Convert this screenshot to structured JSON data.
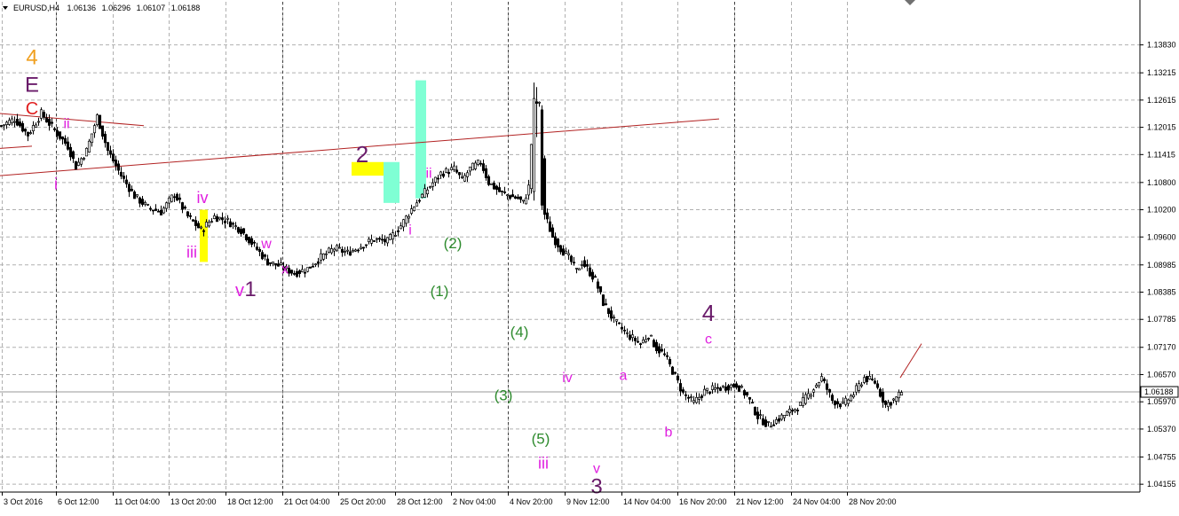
{
  "header": {
    "symbol": "EURUSD,H4",
    "open": "1.06136",
    "high": "1.06296",
    "low": "1.06107",
    "close": "1.06188"
  },
  "colors": {
    "bull": "#ffffff",
    "bear": "#000000",
    "grid": "#b0b0b0",
    "trendline": "#b22222",
    "yellow_box": "#ffff00",
    "teal_box": "#7fffd4",
    "pink": "#e020e0",
    "green": "#2e8b2e",
    "purple": "#6a1b6a",
    "orange": "#f0a020",
    "red": "#e02020",
    "price_line": "#9a9a9a"
  },
  "chart_data": {
    "type": "candlestick",
    "ylim": [
      1.0408,
      1.1435
    ],
    "y_ticks": [
      "1.13830",
      "1.13215",
      "1.12615",
      "1.12015",
      "1.11415",
      "1.10800",
      "1.10200",
      "1.09600",
      "1.08985",
      "1.08385",
      "1.07785",
      "1.07170",
      "1.06570",
      "1.05970",
      "1.05370",
      "1.04755",
      "1.04155"
    ],
    "x_ticks": [
      "3 Oct 2016",
      "6 Oct 12:00",
      "11 Oct 04:00",
      "13 Oct 20:00",
      "18 Oct 12:00",
      "21 Oct 04:00",
      "25 Oct 20:00",
      "28 Oct 12:00",
      "2 Nov 04:00",
      "4 Nov 20:00",
      "9 Nov 12:00",
      "14 Nov 04:00",
      "16 Nov 20:00",
      "21 Nov 12:00",
      "24 Nov 04:00",
      "28 Nov 20:00"
    ],
    "current_price": "1.06188",
    "price_anchors": [
      [
        0,
        1.1205
      ],
      [
        5,
        1.122
      ],
      [
        10,
        1.1185
      ],
      [
        15,
        1.1232
      ],
      [
        20,
        1.1195
      ],
      [
        25,
        1.116
      ],
      [
        28,
        1.1115
      ],
      [
        32,
        1.115
      ],
      [
        36,
        1.1225
      ],
      [
        40,
        1.115
      ],
      [
        45,
        1.1095
      ],
      [
        50,
        1.105
      ],
      [
        55,
        1.1025
      ],
      [
        60,
        1.1015
      ],
      [
        65,
        1.1055
      ],
      [
        70,
        1.1005
      ],
      [
        75,
        1.0975
      ],
      [
        80,
        1.1005
      ],
      [
        85,
        1.0995
      ],
      [
        90,
        1.0975
      ],
      [
        95,
        1.094
      ],
      [
        100,
        1.0905
      ],
      [
        105,
        1.0895
      ],
      [
        110,
        1.088
      ],
      [
        115,
        1.089
      ],
      [
        120,
        1.0915
      ],
      [
        125,
        1.0935
      ],
      [
        130,
        1.0925
      ],
      [
        135,
        1.094
      ],
      [
        140,
        1.0955
      ],
      [
        145,
        1.095
      ],
      [
        150,
        1.0985
      ],
      [
        155,
        1.103
      ],
      [
        160,
        1.1065
      ],
      [
        165,
        1.11
      ],
      [
        170,
        1.111
      ],
      [
        173,
        1.1085
      ],
      [
        176,
        1.111
      ],
      [
        180,
        1.1125
      ],
      [
        183,
        1.108
      ],
      [
        187,
        1.106
      ],
      [
        191,
        1.105
      ],
      [
        194,
        1.1045
      ],
      [
        196,
        1.1035
      ],
      [
        198,
        1.107
      ],
      [
        200,
        1.126
      ],
      [
        202,
        1.125
      ],
      [
        204,
        1.101
      ],
      [
        207,
        1.096
      ],
      [
        210,
        1.0935
      ],
      [
        213,
        1.0915
      ],
      [
        216,
        1.0885
      ],
      [
        218,
        1.0905
      ],
      [
        220,
        1.089
      ],
      [
        223,
        1.0865
      ],
      [
        226,
        1.0815
      ],
      [
        230,
        1.0775
      ],
      [
        235,
        1.0745
      ],
      [
        240,
        1.0725
      ],
      [
        243,
        1.0745
      ],
      [
        246,
        1.0715
      ],
      [
        249,
        1.07
      ],
      [
        252,
        1.0665
      ],
      [
        256,
        1.0615
      ],
      [
        260,
        1.0595
      ],
      [
        264,
        1.062
      ],
      [
        268,
        1.0625
      ],
      [
        272,
        1.063
      ],
      [
        276,
        1.0635
      ],
      [
        280,
        1.061
      ],
      [
        284,
        1.0565
      ],
      [
        288,
        1.0545
      ],
      [
        292,
        1.056
      ],
      [
        296,
        1.0575
      ],
      [
        300,
        1.059
      ],
      [
        304,
        1.062
      ],
      [
        308,
        1.065
      ],
      [
        312,
        1.06
      ],
      [
        316,
        1.059
      ],
      [
        320,
        1.0615
      ],
      [
        324,
        1.065
      ],
      [
        328,
        1.064
      ],
      [
        332,
        1.059
      ],
      [
        336,
        1.0605
      ],
      [
        338,
        1.0619
      ]
    ],
    "trendlines": [
      {
        "from": [
          0,
          1.1232
        ],
        "to": [
          54,
          1.1205
        ]
      },
      {
        "from": [
          0,
          1.1155
        ],
        "to": [
          12,
          1.116
        ]
      },
      {
        "from": [
          0,
          1.1095
        ],
        "to": [
          270,
          1.122
        ]
      },
      {
        "from": [
          338,
          1.065
        ],
        "to": [
          346,
          1.0725
        ]
      }
    ],
    "price_line": 1.06188,
    "boxes": [
      {
        "x0": 75,
        "x1": 77,
        "y0": 1.0905,
        "y1": 1.102,
        "color": "yellow_box"
      },
      {
        "x0": 132,
        "x1": 143,
        "y0": 1.1095,
        "y1": 1.1125,
        "color": "yellow_box"
      },
      {
        "x0": 144,
        "x1": 149,
        "y0": 1.1035,
        "y1": 1.1125,
        "color": "teal_box"
      },
      {
        "x0": 156,
        "x1": 159,
        "y0": 1.1045,
        "y1": 1.1305,
        "color": "teal_box"
      }
    ],
    "wave_labels": [
      {
        "text": "4",
        "x": 12,
        "y": 1.134,
        "color": "orange",
        "size": 24
      },
      {
        "text": "E",
        "x": 12,
        "y": 1.128,
        "color": "purple",
        "size": 24
      },
      {
        "text": "C",
        "x": 12,
        "y": 1.123,
        "color": "red",
        "size": 20
      },
      {
        "text": "i",
        "x": 21,
        "y": 1.1065,
        "color": "pink",
        "size": 18
      },
      {
        "text": "ii",
        "x": 25,
        "y": 1.12,
        "color": "pink",
        "size": 16
      },
      {
        "text": "iv",
        "x": 76,
        "y": 1.1035,
        "color": "pink",
        "size": 18
      },
      {
        "text": "iii",
        "x": 72,
        "y": 1.0915,
        "color": "pink",
        "size": 18
      },
      {
        "text": "v",
        "x": 90,
        "y": 1.083,
        "color": "pink",
        "size": 20
      },
      {
        "text": "1",
        "x": 94,
        "y": 1.083,
        "color": "purple",
        "size": 24
      },
      {
        "text": "w",
        "x": 100,
        "y": 1.0935,
        "color": "pink",
        "size": 16
      },
      {
        "text": "x",
        "x": 107,
        "y": 1.088,
        "color": "pink",
        "size": 16
      },
      {
        "text": "2",
        "x": 136,
        "y": 1.1125,
        "color": "purple",
        "size": 26
      },
      {
        "text": "i",
        "x": 154,
        "y": 1.0965,
        "color": "pink",
        "size": 16
      },
      {
        "text": "ii",
        "x": 161,
        "y": 1.109,
        "color": "pink",
        "size": 16
      },
      {
        "text": "(2)",
        "x": 170,
        "y": 1.0935,
        "color": "green",
        "size": 17
      },
      {
        "text": "(1)",
        "x": 165,
        "y": 1.083,
        "color": "green",
        "size": 17
      },
      {
        "text": "(4)",
        "x": 195,
        "y": 1.074,
        "color": "green",
        "size": 17
      },
      {
        "text": "(3)",
        "x": 189,
        "y": 1.06,
        "color": "green",
        "size": 17
      },
      {
        "text": "iv",
        "x": 213,
        "y": 1.064,
        "color": "pink",
        "size": 16
      },
      {
        "text": "(5)",
        "x": 203,
        "y": 1.0505,
        "color": "green",
        "size": 17
      },
      {
        "text": "iii",
        "x": 204,
        "y": 1.045,
        "color": "pink",
        "size": 18
      },
      {
        "text": "v",
        "x": 224,
        "y": 1.044,
        "color": "pink",
        "size": 16
      },
      {
        "text": "3",
        "x": 224,
        "y": 1.0395,
        "color": "purple",
        "size": 24
      },
      {
        "text": "a",
        "x": 234,
        "y": 1.0645,
        "color": "pink",
        "size": 16
      },
      {
        "text": "b",
        "x": 251,
        "y": 1.052,
        "color": "pink",
        "size": 16
      },
      {
        "text": "4",
        "x": 266,
        "y": 1.0775,
        "color": "purple",
        "size": 26
      },
      {
        "text": "c",
        "x": 266,
        "y": 1.0725,
        "color": "pink",
        "size": 16
      }
    ]
  }
}
